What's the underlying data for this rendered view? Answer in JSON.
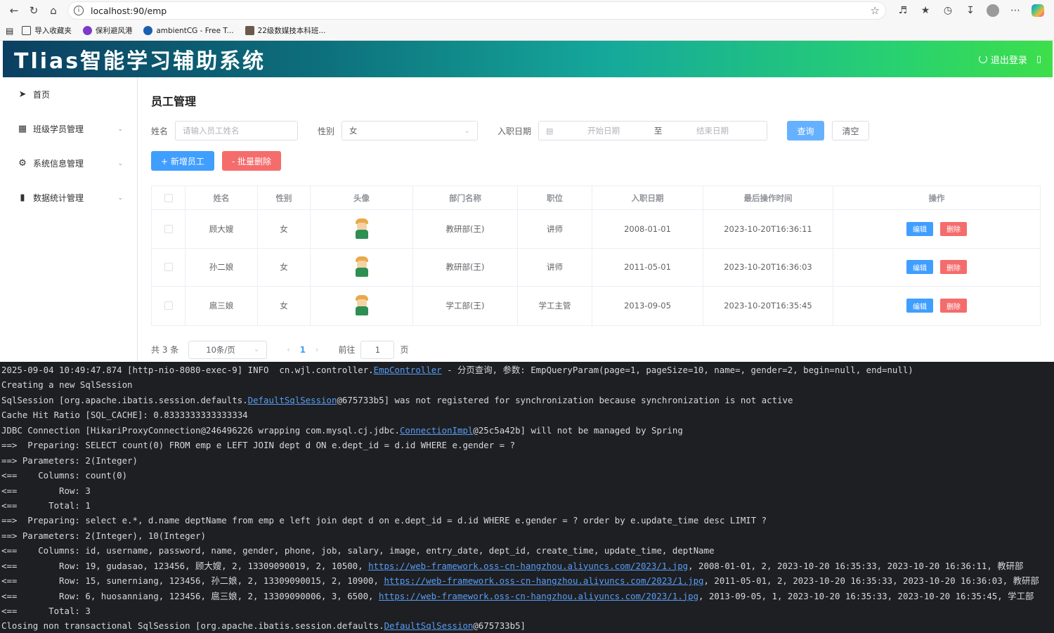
{
  "browser": {
    "url": "localhost:90/emp",
    "bookmarks": [
      "导入收藏夹",
      "保利避风港",
      "ambientCG - Free T...",
      "22级数媒技本科班..."
    ]
  },
  "app": {
    "title": "Tlias智能学习辅助系统",
    "logout_label": "退出登录"
  },
  "sidebar": {
    "items": [
      {
        "label": "首页",
        "icon": "paper-plane-icon"
      },
      {
        "label": "班级学员管理",
        "icon": "grid-icon"
      },
      {
        "label": "系统信息管理",
        "icon": "gear-icon"
      },
      {
        "label": "数据统计管理",
        "icon": "bar-chart-icon"
      }
    ]
  },
  "main": {
    "page_title": "员工管理",
    "search": {
      "name_label": "姓名",
      "name_placeholder": "请输入员工姓名",
      "gender_label": "性别",
      "gender_value": "女",
      "date_label": "入职日期",
      "start_placeholder": "开始日期",
      "range_sep": "至",
      "end_placeholder": "结束日期",
      "query_label": "查询",
      "clear_label": "清空"
    },
    "actions": {
      "add_label": "+ 新增员工",
      "batch_delete_label": "- 批量删除"
    },
    "table": {
      "headers": [
        "姓名",
        "性别",
        "头像",
        "部门名称",
        "职位",
        "入职日期",
        "最后操作时间",
        "操作"
      ],
      "rows": [
        {
          "name": "顾大嫂",
          "gender": "女",
          "dept": "教研部(王)",
          "job": "讲师",
          "entry_date": "2008-01-01",
          "update_time": "2023-10-20T16:36:11"
        },
        {
          "name": "孙二娘",
          "gender": "女",
          "dept": "教研部(王)",
          "job": "讲师",
          "entry_date": "2011-05-01",
          "update_time": "2023-10-20T16:36:03"
        },
        {
          "name": "扈三娘",
          "gender": "女",
          "dept": "学工部(王)",
          "job": "学工主管",
          "entry_date": "2013-09-05",
          "update_time": "2023-10-20T16:35:45"
        }
      ],
      "edit_label": "编辑",
      "delete_label": "删除"
    },
    "pagination": {
      "total_text": "共 3 条",
      "page_size": "10条/页",
      "current_page": "1",
      "goto_label": "前往",
      "goto_value": "1",
      "page_suffix": "页"
    }
  },
  "console": {
    "lines": [
      [
        {
          "t": "2025-09-04 10:49:47.874 [http-nio-8080-exec-9] INFO  cn.wjl.controller."
        },
        {
          "t": "EmpController",
          "link": true
        },
        {
          "t": " - 分页查询, 参数: EmpQueryParam(page=1, pageSize=10, name=, gender=2, begin=null, end=null)"
        }
      ],
      [
        {
          "t": "Creating a new SqlSession"
        }
      ],
      [
        {
          "t": "SqlSession [org.apache.ibatis.session.defaults."
        },
        {
          "t": "DefaultSqlSession",
          "link": true
        },
        {
          "t": "@675733b5] was not registered for synchronization because synchronization is not active"
        }
      ],
      [
        {
          "t": "Cache Hit Ratio [SQL_CACHE]: 0.8333333333333334"
        }
      ],
      [
        {
          "t": "JDBC Connection [HikariProxyConnection@246496226 wrapping com.mysql.cj.jdbc."
        },
        {
          "t": "ConnectionImpl",
          "link": true
        },
        {
          "t": "@25c5a42b] will not be managed by Spring"
        }
      ],
      [
        {
          "t": "==>  Preparing: SELECT count(0) FROM emp e LEFT JOIN dept d ON e.dept_id = d.id WHERE e.gender = ?"
        }
      ],
      [
        {
          "t": "==> Parameters: 2(Integer)"
        }
      ],
      [
        {
          "t": "<==    Columns: count(0)"
        }
      ],
      [
        {
          "t": "<==        Row: 3"
        }
      ],
      [
        {
          "t": "<==      Total: 1"
        }
      ],
      [
        {
          "t": "==>  Preparing: select e.*, d.name deptName from emp e left join dept d on e.dept_id = d.id WHERE e.gender = ? order by e.update_time desc LIMIT ?"
        }
      ],
      [
        {
          "t": "==> Parameters: 2(Integer), 10(Integer)"
        }
      ],
      [
        {
          "t": "<==    Columns: id, username, password, name, gender, phone, job, salary, image, entry_date, dept_id, create_time, update_time, deptName"
        }
      ],
      [
        {
          "t": "<==        Row: 19, gudasao, 123456, 顾大嫂, 2, 13309090019, 2, 10500, "
        },
        {
          "t": "https://web-framework.oss-cn-hangzhou.aliyuncs.com/2023/1.jpg",
          "link": true
        },
        {
          "t": ", 2008-01-01, 2, 2023-10-20 16:35:33, 2023-10-20 16:36:11, 教研部"
        }
      ],
      [
        {
          "t": "<==        Row: 15, sunerniang, 123456, 孙二娘, 2, 13309090015, 2, 10900, "
        },
        {
          "t": "https://web-framework.oss-cn-hangzhou.aliyuncs.com/2023/1.jpg",
          "link": true
        },
        {
          "t": ", 2011-05-01, 2, 2023-10-20 16:35:33, 2023-10-20 16:36:03, 教研部"
        }
      ],
      [
        {
          "t": "<==        Row: 6, huosanniang, 123456, 扈三娘, 2, 13309090006, 3, 6500, "
        },
        {
          "t": "https://web-framework.oss-cn-hangzhou.aliyuncs.com/2023/1.jpg",
          "link": true
        },
        {
          "t": ", 2013-09-05, 1, 2023-10-20 16:35:33, 2023-10-20 16:35:45, 学工部"
        }
      ],
      [
        {
          "t": "<==      Total: 3"
        }
      ],
      [
        {
          "t": "Closing non transactional SqlSession [org.apache.ibatis.session.defaults."
        },
        {
          "t": "DefaultSqlSession",
          "link": true
        },
        {
          "t": "@675733b5]"
        }
      ]
    ]
  }
}
